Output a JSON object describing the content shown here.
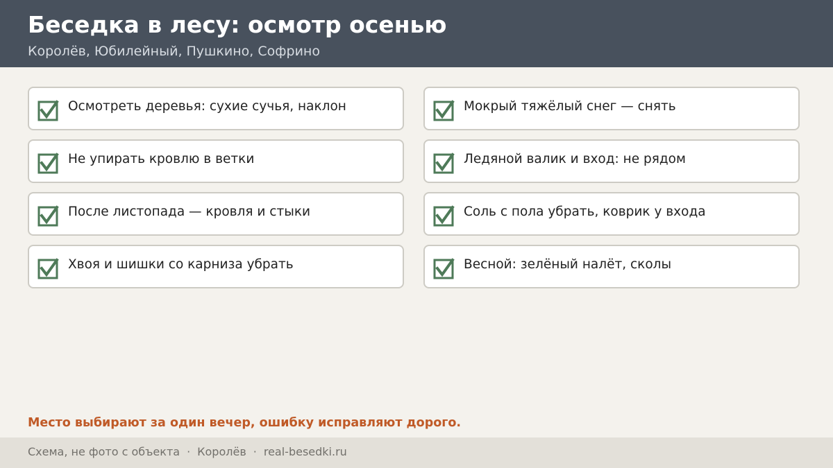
{
  "header": {
    "title": "Беседка в лесу: осмотр осенью",
    "subtitle": "Королёв, Юбилейный, Пушкино, Софрино"
  },
  "checklist": {
    "left": [
      {
        "text": "Осмотреть деревья: сухие сучья, наклон",
        "checked": true
      },
      {
        "text": "Не упирать кровлю в ветки",
        "checked": true
      },
      {
        "text": "После листопада — кровля и стыки",
        "checked": true
      },
      {
        "text": "Хвоя и шишки со карниза убрать",
        "checked": true
      }
    ],
    "right": [
      {
        "text": "Мокрый тяжёлый снег — снять",
        "checked": true
      },
      {
        "text": "Ледяной валик и вход: не рядом",
        "checked": true
      },
      {
        "text": "Соль с пола убрать, коврик у входа",
        "checked": true
      },
      {
        "text": "Весной: зелёный налёт, сколы",
        "checked": true
      }
    ]
  },
  "warning": "Место выбирают за один вечер, ошибку исправляют дорого.",
  "footer": {
    "note": "Схема, не фото с объекта",
    "separator": "·",
    "city": "Королёв",
    "site": "real-besedki.ru"
  },
  "colors": {
    "header_bg": "#48515d",
    "page_bg": "#f4f2ed",
    "check_green": "#4e7a58",
    "warning_orange": "#c05a27",
    "footer_bg": "#e3e0d9"
  }
}
